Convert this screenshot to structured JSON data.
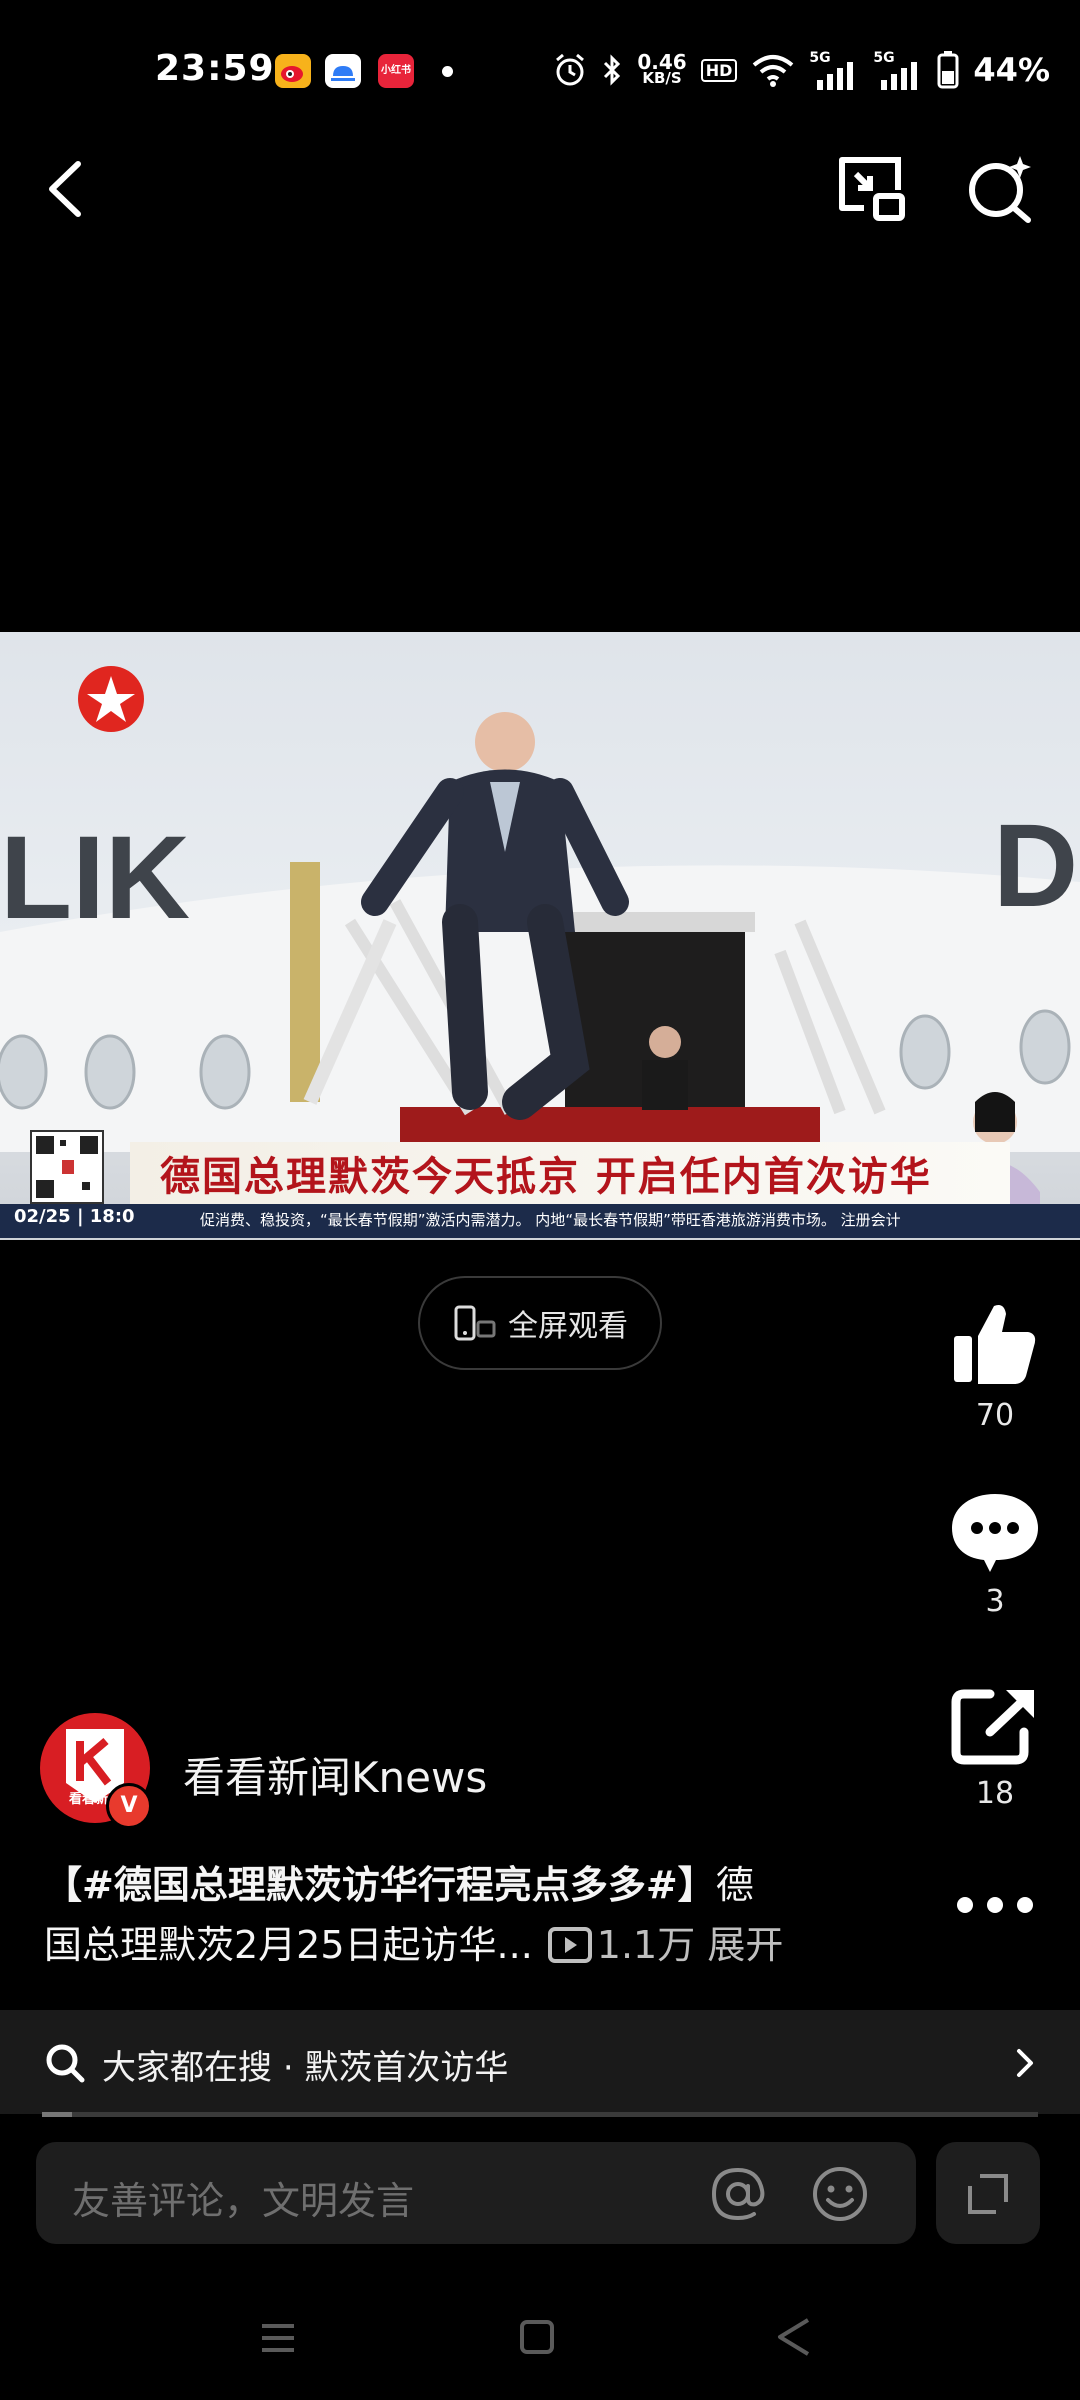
{
  "status_bar": {
    "time": "23:59",
    "apps": [
      {
        "icon": "weibo-icon",
        "color": "#f7b21b"
      },
      {
        "icon": "cloud-app-icon",
        "color": "#2f7cf6"
      },
      {
        "icon": "xiaohongshu-icon",
        "color": "#e8243a",
        "label": "小红书"
      }
    ],
    "net_speed_value": "0.46",
    "net_speed_unit": "KB/S",
    "hd_label": "HD",
    "sig1_label": "5G",
    "sig2_label": "5G",
    "battery_percent": "44%"
  },
  "top_bar": {
    "back_icon": "chevron-left-icon",
    "pip_icon": "picture-in-picture-icon",
    "search_icon": "ai-search-icon"
  },
  "video": {
    "channel_logo": "dragon-tv-star-logo",
    "caption_title": "德国总理默茨今天抵京 开启任内首次访华",
    "ticker_date": "02/25",
    "ticker_time": "18:0",
    "ticker_text": "促消费、稳投资，“最长春节假期”激活内需潜力。    内地“最长春节假期”带旺香港旅游消费市场。    注册会计",
    "plane_text_left": "LIK",
    "plane_text_right": "D"
  },
  "fullscreen_button": {
    "label": "全屏观看"
  },
  "actions": {
    "like_count": "70",
    "comment_count": "3",
    "share_count": "18"
  },
  "author": {
    "name": "看看新闻Knews",
    "avatar_label": "看看新闻",
    "verified_badge": "V"
  },
  "description": {
    "hashtag": "【#德国总理默茨访华行程亮点多多#】",
    "text_part1": "德",
    "text_part2": "国总理默茨2月25日起访华...",
    "play_count": "1.1万",
    "expand_label": "展开"
  },
  "search_suggestion": {
    "prefix": "大家都在搜",
    "separator": "·",
    "query": "默茨首次访华"
  },
  "progress": {
    "fraction": 0.03
  },
  "comment_bar": {
    "placeholder": "友善评论，文明发言"
  }
}
